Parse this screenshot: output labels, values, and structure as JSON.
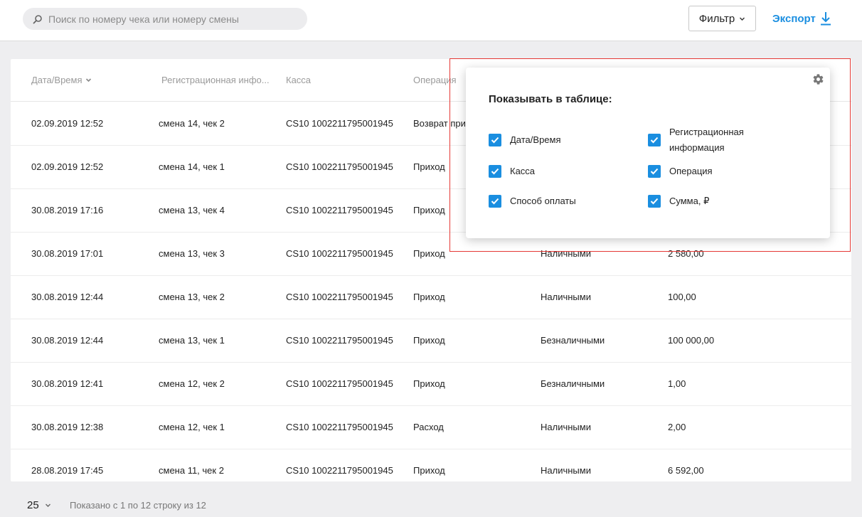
{
  "header": {
    "search_placeholder": "Поиск по номеру чека или номеру смены",
    "filter_label": "Фильтр",
    "export_label": "Экспорт"
  },
  "table": {
    "columns": [
      "Дата/Время",
      "Регистрационная инфо...",
      "Касса",
      "Операция"
    ],
    "rows": [
      [
        "02.09.2019 12:52",
        "смена 14, чек 2",
        "CS10 1002211795001945",
        "Возврат при",
        "",
        ""
      ],
      [
        "02.09.2019 12:52",
        "смена 14, чек 1",
        "CS10 1002211795001945",
        "Приход",
        "",
        ""
      ],
      [
        "30.08.2019 17:16",
        "смена 13, чек 4",
        "CS10 1002211795001945",
        "Приход",
        "",
        ""
      ],
      [
        "30.08.2019 17:01",
        "смена 13, чек 3",
        "CS10 1002211795001945",
        "Приход",
        "Наличными",
        "2 580,00"
      ],
      [
        "30.08.2019 12:44",
        "смена 13, чек 2",
        "CS10 1002211795001945",
        "Приход",
        "Наличными",
        "100,00"
      ],
      [
        "30.08.2019 12:44",
        "смена 13, чек 1",
        "CS10 1002211795001945",
        "Приход",
        "Безналичными",
        "100 000,00"
      ],
      [
        "30.08.2019 12:41",
        "смена 12, чек 2",
        "CS10 1002211795001945",
        "Приход",
        "Безналичными",
        "1,00"
      ],
      [
        "30.08.2019 12:38",
        "смена 12, чек 1",
        "CS10 1002211795001945",
        "Расход",
        "Наличными",
        "2,00"
      ],
      [
        "28.08.2019 17:45",
        "смена 11, чек 2",
        "CS10 1002211795001945",
        "Приход",
        "Наличными",
        "6 592,00"
      ]
    ]
  },
  "footer": {
    "page_size": "25",
    "shown_info": "Показано с 1 по 12 строку из 12"
  },
  "popover": {
    "title": "Показывать в таблице:",
    "options": [
      {
        "label": "Дата/Время",
        "checked": true
      },
      {
        "label": "Регистрационная информация",
        "checked": true
      },
      {
        "label": "Касса",
        "checked": true
      },
      {
        "label": "Операция",
        "checked": true
      },
      {
        "label": "Способ оплаты",
        "checked": true
      },
      {
        "label": "Сумма, ₽",
        "checked": true
      }
    ]
  },
  "colors": {
    "accent": "#1a8ee0",
    "highlight": "#e53935",
    "background": "#eeeef0"
  },
  "icons": [
    "search-icon",
    "chevron-down-icon",
    "download-icon",
    "gear-icon",
    "check-icon"
  ]
}
